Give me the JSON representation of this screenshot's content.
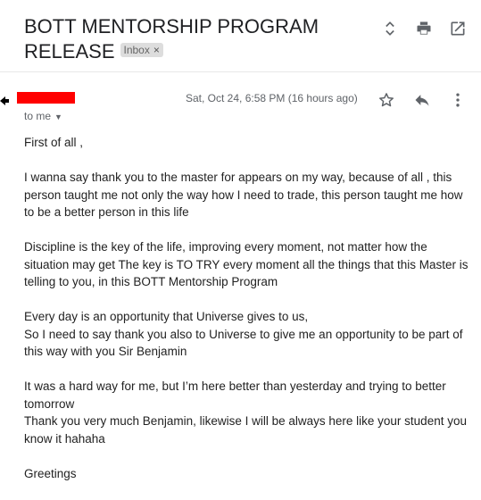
{
  "subject": {
    "line1": "BOTT MENTORSHIP PROGRAM",
    "line2": "RELEASE",
    "label": "Inbox",
    "label_remove": "×"
  },
  "message": {
    "date": "Sat, Oct 24, 6:58 PM (16 hours ago)",
    "recipient": "to me",
    "paragraphs": [
      [
        "First of all ,"
      ],
      [
        "I wanna say thank you to the master for appears on my  way, because of all , this",
        "person taught me not only the way how I need to trade, this person taught me how",
        "to be a better person in this life"
      ],
      [
        "Discipline is the key of the life, improving every moment, not matter how the",
        "situation may get The key is TO TRY every moment all the things that this Master is",
        "telling to you, in this BOTT Mentorship Program"
      ],
      [
        "Every day is an opportunity that Universe gives to us,",
        "So I need to say thank you also to Universe to give me an opportunity to be part of",
        "this way with you Sir Benjamin"
      ],
      [
        "It was a hard way for me, but I’m here better than yesterday and trying to better",
        "tomorrow",
        "Thank you very much Benjamin, likewise I will be always here like your student you",
        "know it hahaha"
      ],
      [
        "Greetings"
      ]
    ]
  },
  "icons": {
    "expand": "unfold-more-icon",
    "print": "print-icon",
    "popout": "open-in-new-icon",
    "star": "star-icon",
    "reply": "reply-icon",
    "more": "more-vert-icon"
  },
  "colors": {
    "redaction": "#ff0000",
    "icon": "#5f6368"
  }
}
